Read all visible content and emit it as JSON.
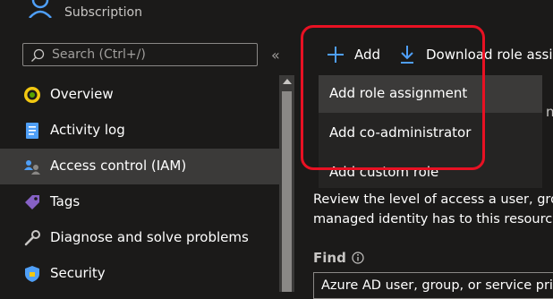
{
  "header": {
    "subtitle": "Subscription"
  },
  "search": {
    "placeholder": "Search (Ctrl+/)"
  },
  "collapse": {
    "glyph": "«"
  },
  "sidebar": {
    "items": [
      {
        "label": "Overview",
        "icon": "overview-icon"
      },
      {
        "label": "Activity log",
        "icon": "activity-log-icon"
      },
      {
        "label": "Access control (IAM)",
        "icon": "iam-icon",
        "selected": true
      },
      {
        "label": "Tags",
        "icon": "tag-icon"
      },
      {
        "label": "Diagnose and solve problems",
        "icon": "wrench-icon"
      },
      {
        "label": "Security",
        "icon": "shield-icon"
      }
    ]
  },
  "toolbar": {
    "add_label": "Add",
    "download_label": "Download role assig"
  },
  "add_menu": {
    "items": [
      {
        "label": "Add role assignment"
      },
      {
        "label": "Add co-administrator"
      },
      {
        "label": "Add custom role"
      }
    ]
  },
  "main": {
    "review_line1": "Review the level of access a user, grou",
    "review_line2": "managed identity has to this resource",
    "find_label": "Find",
    "find_placeholder": "Azure AD user, group, or service prin"
  },
  "colors": {
    "accent": "#4f9ff7",
    "annotation": "#e81123",
    "selected_bg": "#3b3a39"
  }
}
